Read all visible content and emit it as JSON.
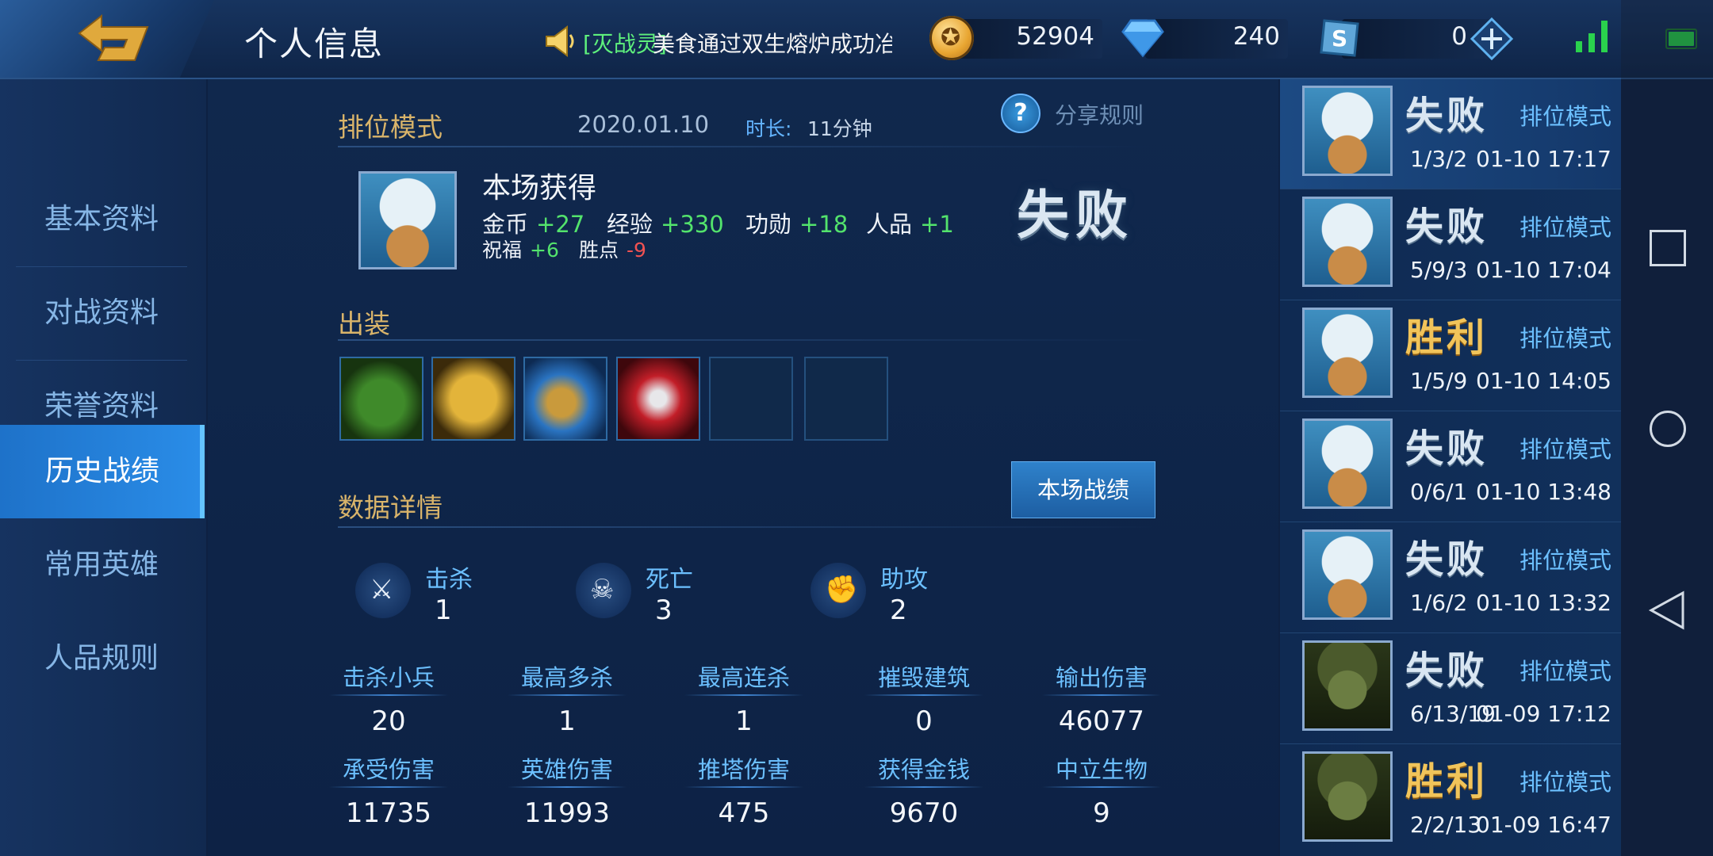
{
  "header": {
    "title": "个人信息",
    "ticker_highlight": "[灭战灵]",
    "ticker_text": "美食通过双生熔炉成功冶炼",
    "gold": "52904",
    "diamonds": "240",
    "points": "0"
  },
  "nav": {
    "items": [
      "基本资料",
      "对战资料",
      "荣誉资料",
      "历史战绩",
      "常用英雄",
      "人品规则"
    ],
    "active_index": 3
  },
  "match": {
    "mode": "排位模式",
    "date": "2020.01.10",
    "duration_label": "时长:",
    "duration": "11分钟",
    "share_rule": "分享规则",
    "gains_title": "本场获得",
    "gains": [
      {
        "label": "金币",
        "value": "+27"
      },
      {
        "label": "经验",
        "value": "+330"
      },
      {
        "label": "功勋",
        "value": "+18"
      },
      {
        "label": "人品",
        "value": "+1"
      },
      {
        "label": "祝福",
        "value": "+6"
      },
      {
        "label": "胜点",
        "value": "-9"
      }
    ],
    "result": "失败",
    "equipment_title": "出装",
    "details_title": "数据详情",
    "battle_button": "本场战绩",
    "kda": [
      {
        "label": "击杀",
        "value": "1"
      },
      {
        "label": "死亡",
        "value": "3"
      },
      {
        "label": "助攻",
        "value": "2"
      }
    ],
    "stats": [
      {
        "label": "击杀小兵",
        "value": "20"
      },
      {
        "label": "最高多杀",
        "value": "1"
      },
      {
        "label": "最高连杀",
        "value": "1"
      },
      {
        "label": "摧毁建筑",
        "value": "0"
      },
      {
        "label": "输出伤害",
        "value": "46077"
      },
      {
        "label": "承受伤害",
        "value": "11735"
      },
      {
        "label": "英雄伤害",
        "value": "11993"
      },
      {
        "label": "推塔伤害",
        "value": "475"
      },
      {
        "label": "获得金钱",
        "value": "9670"
      },
      {
        "label": "中立生物",
        "value": "9"
      }
    ]
  },
  "history": [
    {
      "result": "失败",
      "mode": "排位模式",
      "kda": "1/3/2",
      "time": "01-10 17:17"
    },
    {
      "result": "失败",
      "mode": "排位模式",
      "kda": "5/9/3",
      "time": "01-10 17:04"
    },
    {
      "result": "胜利",
      "mode": "排位模式",
      "kda": "1/5/9",
      "time": "01-10 14:05"
    },
    {
      "result": "失败",
      "mode": "排位模式",
      "kda": "0/6/1",
      "time": "01-10 13:48"
    },
    {
      "result": "失败",
      "mode": "排位模式",
      "kda": "1/6/2",
      "time": "01-10 13:32"
    },
    {
      "result": "失败",
      "mode": "排位模式",
      "kda": "6/13/19",
      "time": "01-09 17:12"
    },
    {
      "result": "胜利",
      "mode": "排位模式",
      "kda": "2/2/13",
      "time": "01-09 16:47"
    }
  ],
  "colors": {
    "gain_positive": "#53e36c",
    "gain_negative": "#f05252",
    "accent": "#6cc0ff",
    "gold_title": "#d9b46a"
  }
}
